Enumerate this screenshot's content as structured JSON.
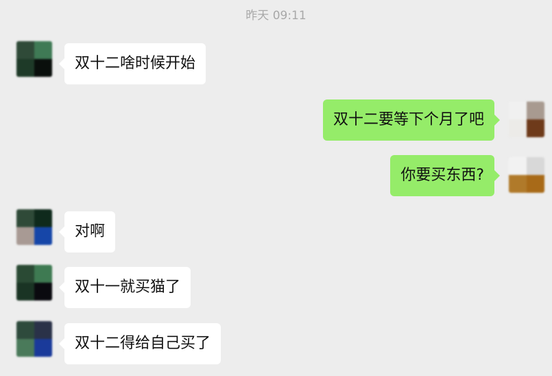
{
  "chat": {
    "timestamp": "昨天 09:11",
    "messages": [
      {
        "side": "left",
        "text": "双十二啥时候开始"
      },
      {
        "side": "right",
        "text": "双十二要等下个月了吧"
      },
      {
        "side": "right",
        "text": "你要买东西?"
      },
      {
        "side": "left",
        "text": "对啊"
      },
      {
        "side": "left",
        "text": "双十一就买猫了"
      },
      {
        "side": "left",
        "text": "双十二得给自己买了"
      }
    ]
  },
  "colors": {
    "background": "#ededed",
    "incoming_bubble": "#ffffff",
    "outgoing_bubble": "#95ec69",
    "timestamp_text": "#a8a8a8"
  }
}
